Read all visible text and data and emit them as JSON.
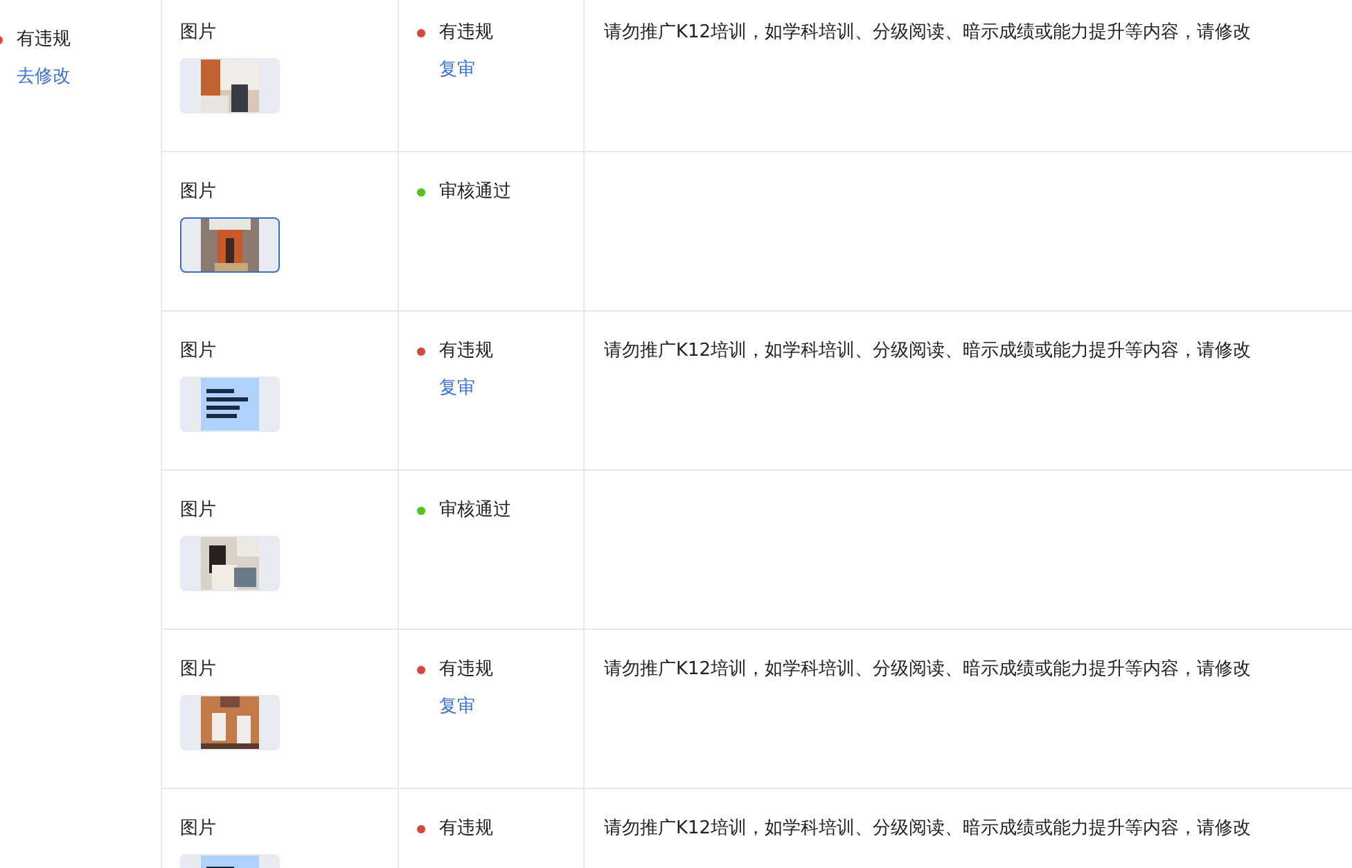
{
  "summary": {
    "status": {
      "label": "有违规",
      "color": "#d9463b"
    },
    "action": "去修改"
  },
  "rows": [
    {
      "type": "图片",
      "thumbnail": {
        "kind": "picture",
        "selected": false
      },
      "status": {
        "label": "有违规",
        "color": "#d9463b"
      },
      "action": "复审",
      "reason": "请勿推广K12培训，如学科培训、分级阅读、暗示成绩或能力提升等内容，请修改"
    },
    {
      "type": "图片",
      "thumbnail": {
        "kind": "picture",
        "selected": true
      },
      "status": {
        "label": "审核通过",
        "color": "#52c41a"
      }
    },
    {
      "type": "图片",
      "thumbnail": {
        "kind": "picture",
        "selected": false
      },
      "status": {
        "label": "有违规",
        "color": "#d9463b"
      },
      "action": "复审",
      "reason": "请勿推广K12培训，如学科培训、分级阅读、暗示成绩或能力提升等内容，请修改"
    },
    {
      "type": "图片",
      "thumbnail": {
        "kind": "picture",
        "selected": false
      },
      "status": {
        "label": "审核通过",
        "color": "#52c41a"
      }
    },
    {
      "type": "图片",
      "thumbnail": {
        "kind": "picture",
        "selected": false
      },
      "status": {
        "label": "有违规",
        "color": "#d9463b"
      },
      "action": "复审",
      "reason": "请勿推广K12培训，如学科培训、分级阅读、暗示成绩或能力提升等内容，请修改"
    },
    {
      "type": "图片",
      "thumbnail": {
        "kind": "picture",
        "selected": false
      },
      "status": {
        "label": "有违规",
        "color": "#d9463b"
      },
      "reason": "请勿推广K12培训，如学科培训、分级阅读、暗示成绩或能力提升等内容，请修改"
    }
  ]
}
